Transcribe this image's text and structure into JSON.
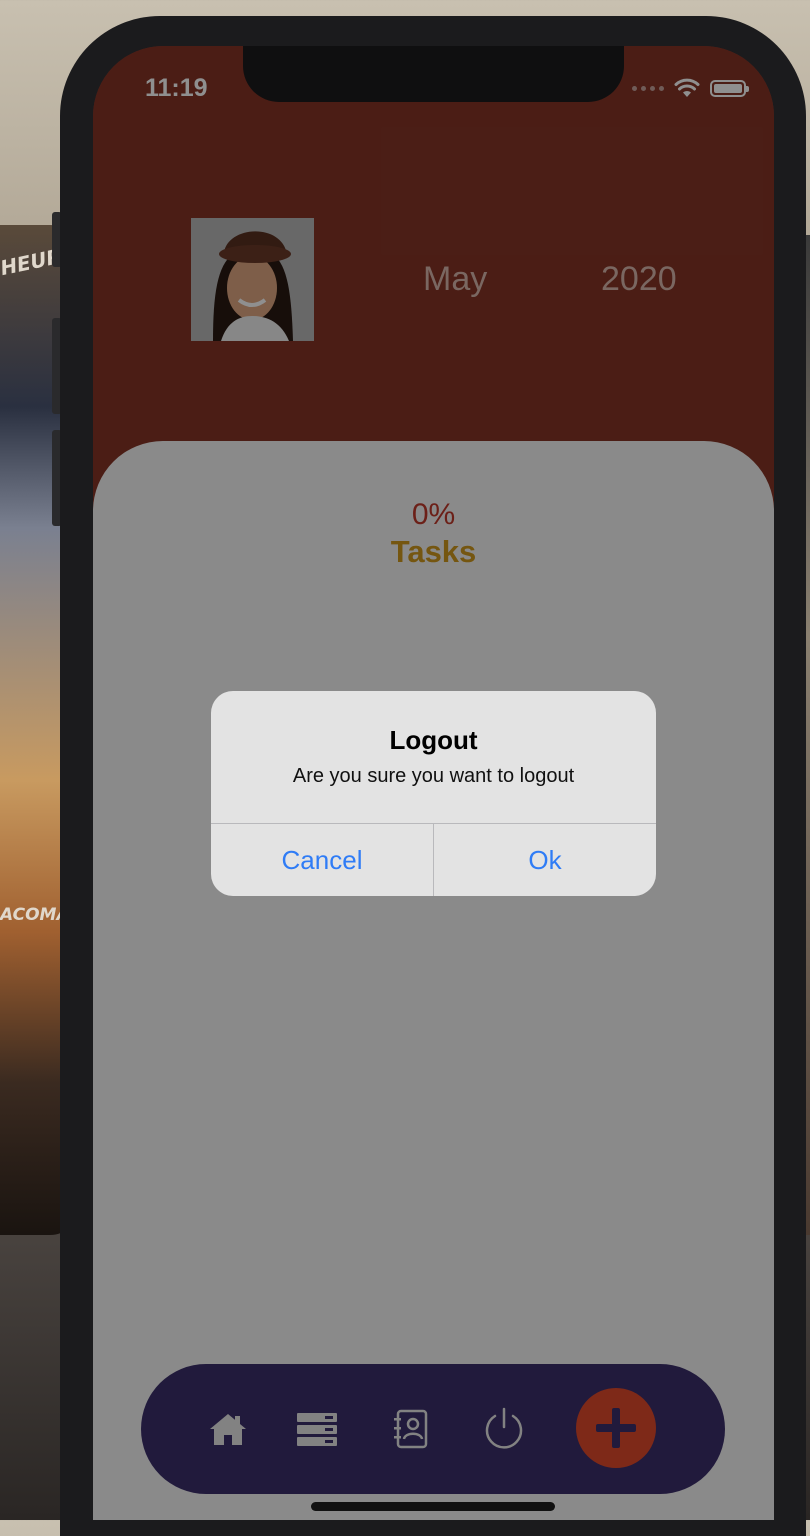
{
  "status_bar": {
    "time": "11:19"
  },
  "header": {
    "month": "May",
    "year": "2020"
  },
  "progress": {
    "percent_label": "0%",
    "tasks_label": "Tasks",
    "value": 0
  },
  "dialog": {
    "title": "Logout",
    "message": "Are you sure you want to logout",
    "cancel_label": "Cancel",
    "ok_label": "Ok"
  },
  "background": {
    "truck_text_1": "HEUR",
    "truck_text_2": "ACOMA"
  },
  "tab_bar": {
    "items": [
      {
        "icon": "home-icon"
      },
      {
        "icon": "list-icon"
      },
      {
        "icon": "contacts-icon"
      },
      {
        "icon": "power-icon"
      },
      {
        "icon": "add-icon"
      }
    ]
  },
  "colors": {
    "header": "#863527",
    "tab_bar": "#3b2f6b",
    "accent_button": "#e14a2b",
    "dialog_button": "#2f7cf6",
    "percent": "#c0392b",
    "tasks": "#d19a1e"
  }
}
